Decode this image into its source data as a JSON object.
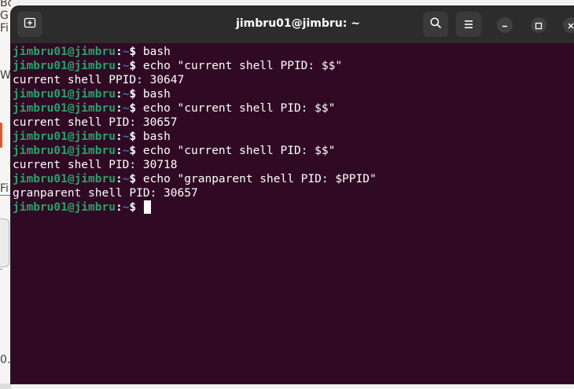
{
  "background_window": {
    "fragments": [
      "Bo",
      "G",
      "Fi",
      "W",
      "Fi",
      "0."
    ]
  },
  "window": {
    "title": "jimbru01@jimbru: ~"
  },
  "terminal": {
    "lines": [
      {
        "type": "prompt",
        "user": "jimbru01@jimbru",
        "sep": ":",
        "path": "~",
        "symbol": "$ ",
        "command": "bash"
      },
      {
        "type": "prompt",
        "user": "jimbru01@jimbru",
        "sep": ":",
        "path": "~",
        "symbol": "$ ",
        "command": "echo \"current shell PPID: $$\""
      },
      {
        "type": "output",
        "text": "current shell PPID: 30647"
      },
      {
        "type": "prompt",
        "user": "jimbru01@jimbru",
        "sep": ":",
        "path": "~",
        "symbol": "$ ",
        "command": "bash"
      },
      {
        "type": "prompt",
        "user": "jimbru01@jimbru",
        "sep": ":",
        "path": "~",
        "symbol": "$ ",
        "command": "echo \"current shell PID: $$\""
      },
      {
        "type": "output",
        "text": "current shell PID: 30657"
      },
      {
        "type": "prompt",
        "user": "jimbru01@jimbru",
        "sep": ":",
        "path": "~",
        "symbol": "$ ",
        "command": "bash"
      },
      {
        "type": "prompt",
        "user": "jimbru01@jimbru",
        "sep": ":",
        "path": "~",
        "symbol": "$ ",
        "command": "echo \"current shell PID: $$\""
      },
      {
        "type": "output",
        "text": "current shell PID: 30718"
      },
      {
        "type": "prompt",
        "user": "jimbru01@jimbru",
        "sep": ":",
        "path": "~",
        "symbol": "$ ",
        "command": "echo \"granparent shell PID: $PPID\""
      },
      {
        "type": "output",
        "text": "granparent shell PID: 30657"
      },
      {
        "type": "prompt",
        "user": "jimbru01@jimbru",
        "sep": ":",
        "path": "~",
        "symbol": "$ ",
        "command": "",
        "cursor": true
      }
    ]
  },
  "icons": {
    "new_tab": "new-tab-icon",
    "search": "search-icon",
    "menu": "hamburger-menu-icon",
    "minimize": "minimize-icon",
    "maximize": "maximize-icon",
    "close": "close-icon"
  },
  "colors": {
    "terminal_bg": "#300a24",
    "titlebar_bg": "#2c2c2c",
    "prompt_user": "#26a269",
    "prompt_path": "#3f6fb0",
    "text": "#ffffff"
  }
}
